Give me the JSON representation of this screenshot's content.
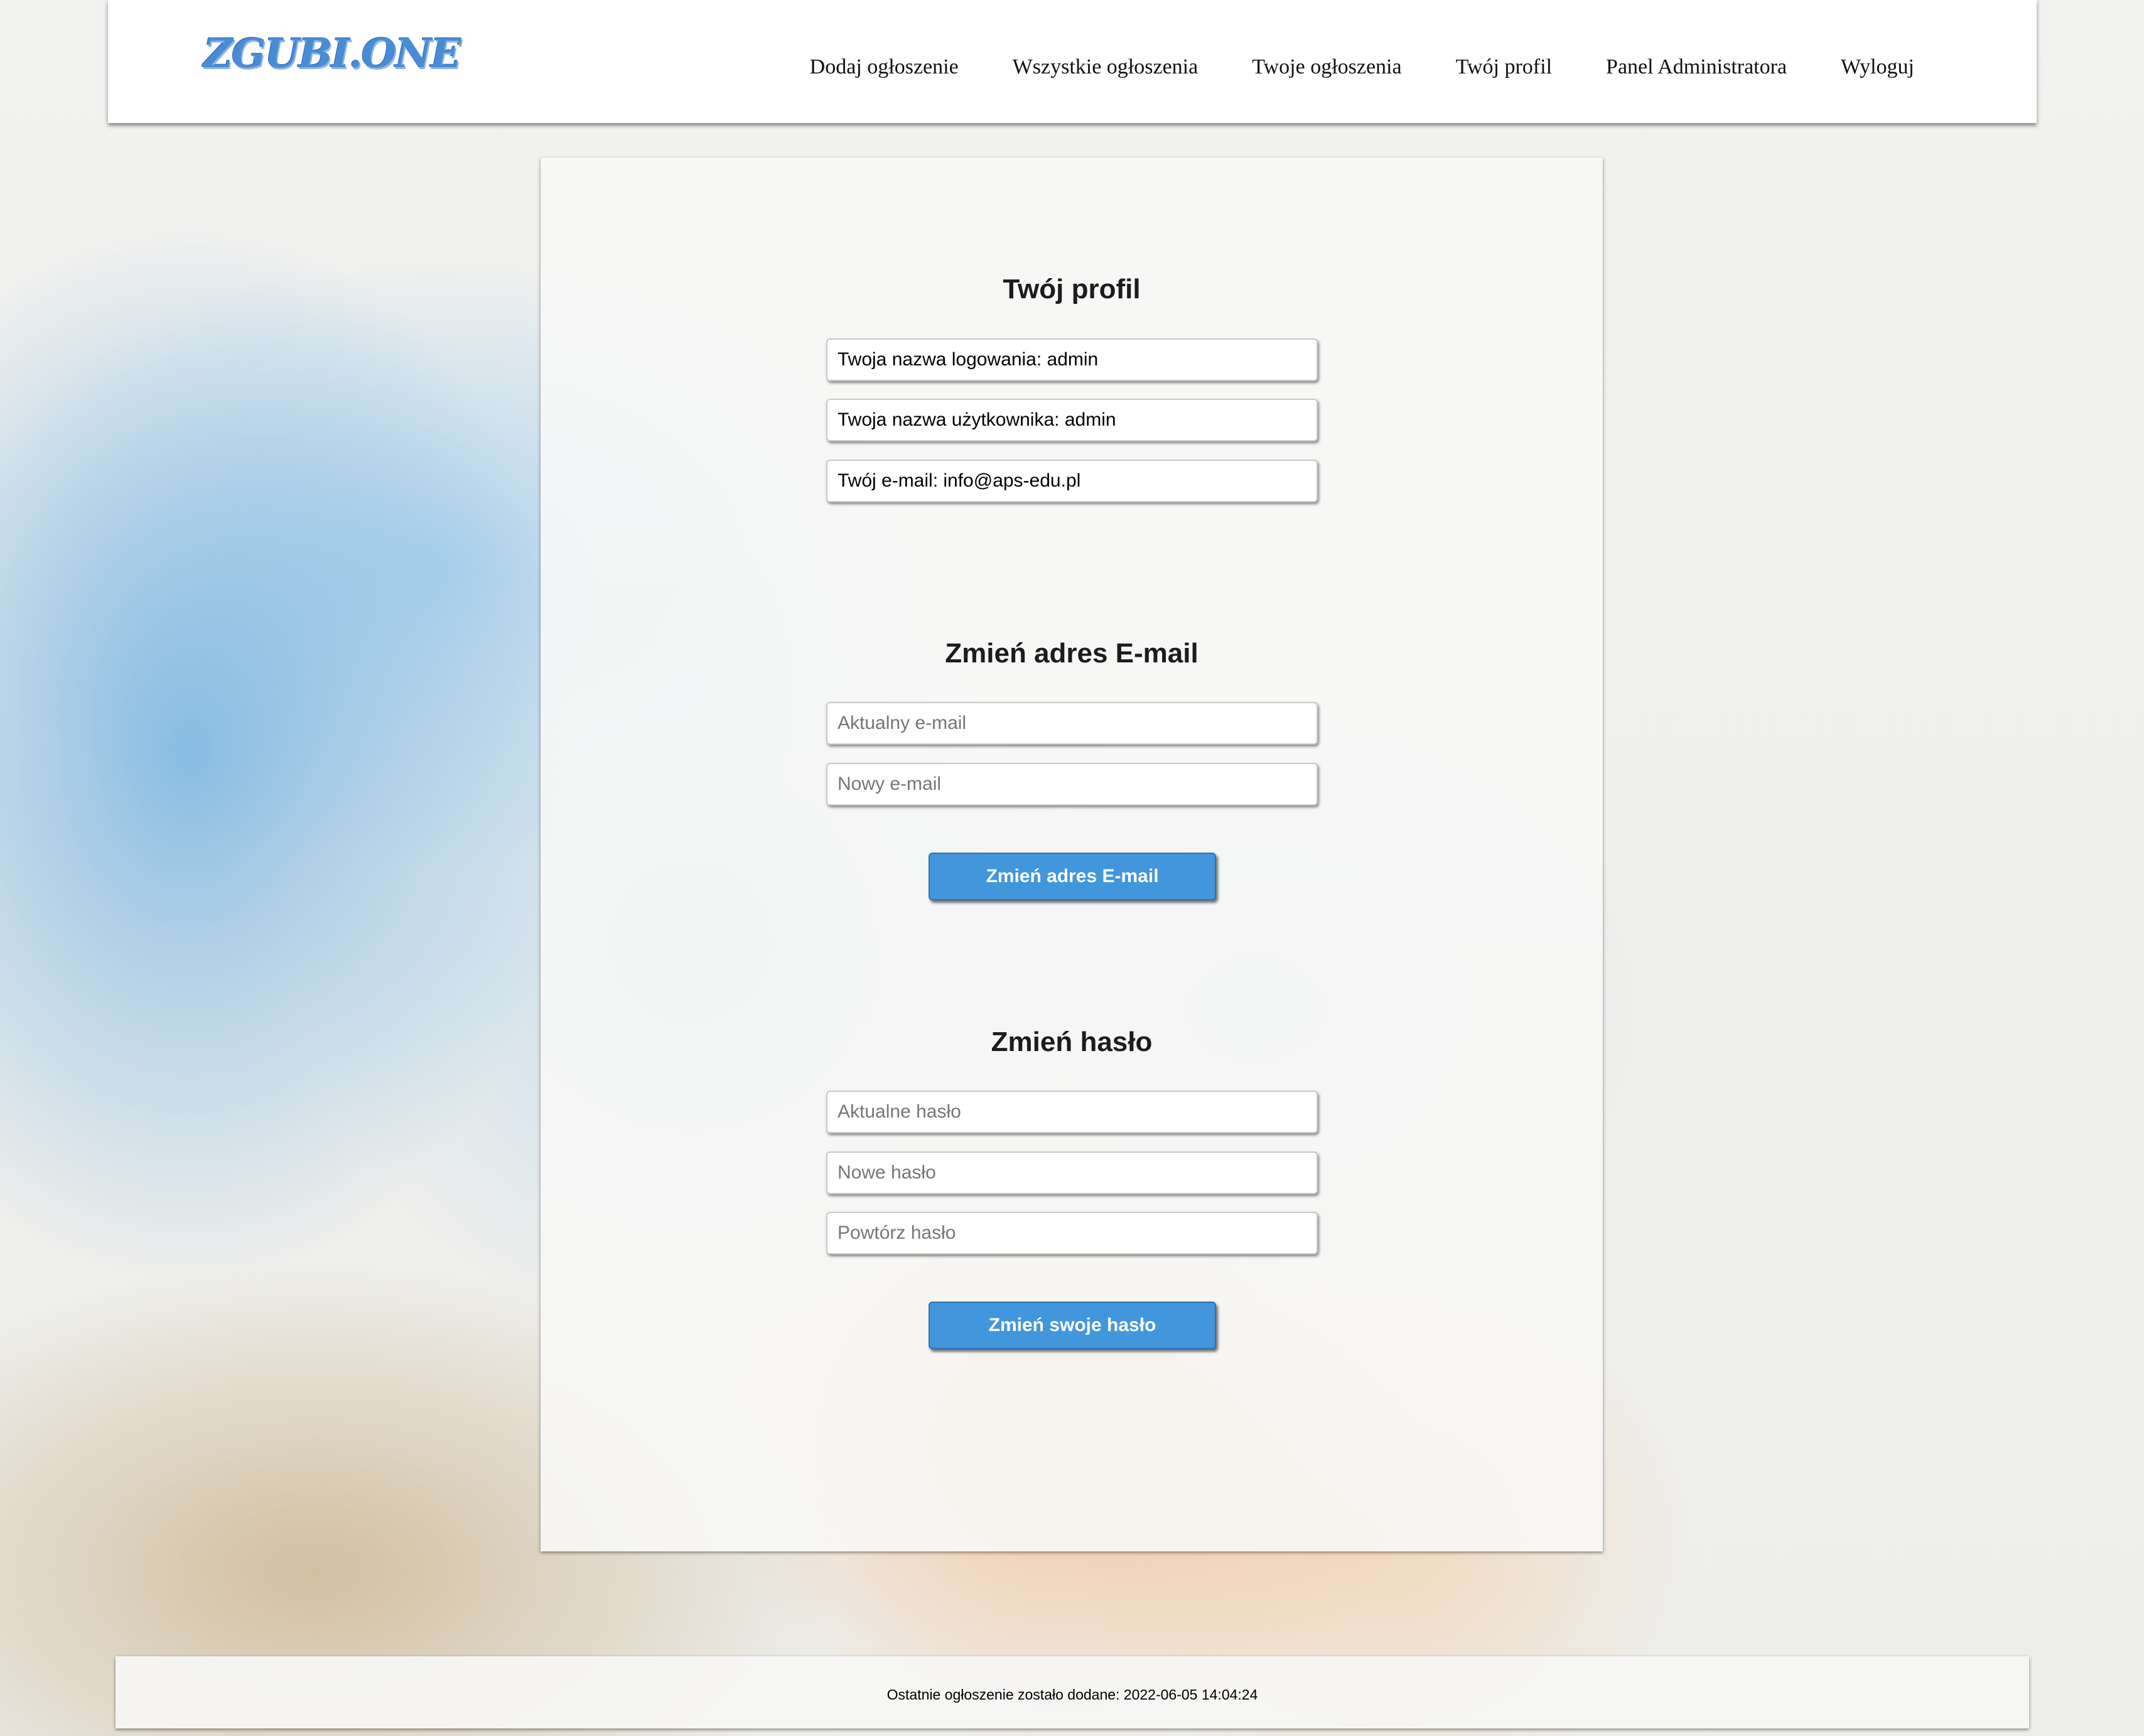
{
  "header": {
    "logo": "ZGUBI.ONE",
    "nav": [
      "Dodaj ogłoszenie",
      "Wszystkie ogłoszenia",
      "Twoje ogłoszenia",
      "Twój profil",
      "Panel Administratora",
      "Wyloguj"
    ]
  },
  "profile": {
    "title": "Twój profil",
    "login": "Twoja nazwa logowania: admin",
    "username": "Twoja nazwa użytkownika: admin",
    "email": "Twój e-mail: info@aps-edu.pl"
  },
  "change_email": {
    "title": "Zmień adres E-mail",
    "current_placeholder": "Aktualny e-mail",
    "new_placeholder": "Nowy e-mail",
    "button": "Zmień adres E-mail"
  },
  "change_password": {
    "title": "Zmień hasło",
    "current_placeholder": "Aktualne hasło",
    "new_placeholder": "Nowe hasło",
    "repeat_placeholder": "Powtórz hasło",
    "button": "Zmień swoje hasło"
  },
  "footer": {
    "text": "Ostatnie ogłoszenie zostało dodane: 2022-06-05 14:04:24"
  },
  "colors": {
    "accent": "#4296dc",
    "logo": "#4a8bd6"
  }
}
